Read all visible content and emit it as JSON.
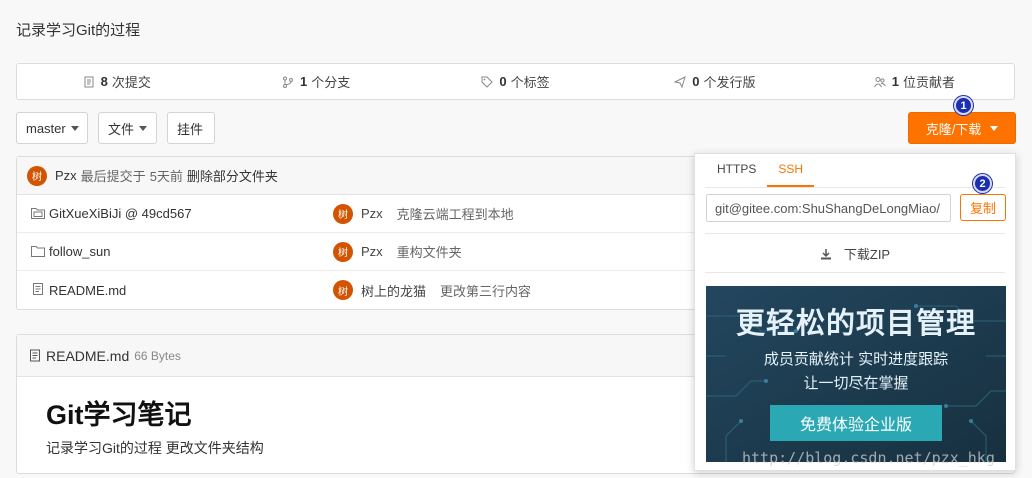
{
  "repo": {
    "description": "记录学习Git的过程"
  },
  "stats": [
    {
      "icon": "commit-icon",
      "count": "8",
      "label": "次提交"
    },
    {
      "icon": "branch-icon",
      "count": "1",
      "label": "个分支"
    },
    {
      "icon": "tag-icon",
      "count": "0",
      "label": "个标签"
    },
    {
      "icon": "release-icon",
      "count": "0",
      "label": "个发行版"
    },
    {
      "icon": "contributors-icon",
      "count": "1",
      "label": "位贡献者"
    }
  ],
  "toolbar": {
    "branch": "master",
    "file": "文件",
    "plugin": "挂件",
    "clone": "克隆/下载"
  },
  "markers": {
    "one": "1",
    "two": "2"
  },
  "latest_commit": {
    "avatar_char": "树",
    "author": "Pzx",
    "prefix": "最后提交于",
    "time": "5天前",
    "message": "删除部分文件夹"
  },
  "files": [
    {
      "icon": "submodule-folder-icon",
      "name": "GitXueXiBiJi @ 49cd567",
      "avatar_char": "树",
      "author": "Pzx",
      "message": "克隆云端工程到本地"
    },
    {
      "icon": "folder-icon",
      "name": "follow_sun",
      "avatar_char": "树",
      "author": "Pzx",
      "message": "重构文件夹"
    },
    {
      "icon": "file-icon",
      "name": "README.md",
      "avatar_char": "树",
      "author": "树上的龙猫",
      "message": "更改第三行内容"
    }
  ],
  "readme": {
    "filename": "README.md",
    "size": "66 Bytes",
    "title": "Git学习笔记",
    "text": "记录学习Git的过程 更改文件夹结构"
  },
  "clone_panel": {
    "tabs": [
      "HTTPS",
      "SSH"
    ],
    "active_tab": "SSH",
    "url": "git@gitee.com:ShuShangDeLongMiao/",
    "copy_label": "复制",
    "download_zip": "下载ZIP"
  },
  "promo": {
    "title": "更轻松的项目管理",
    "line1": "成员贡献统计   实时进度跟踪",
    "line2": "让一切尽在掌握",
    "button": "免费体验企业版"
  },
  "watermark": "http://blog.csdn.net/pzx_hkg",
  "colors": {
    "accent": "#fe7300",
    "promo_bg": "#1d3c53",
    "promo_button": "#2aa9b5",
    "avatar": "#d35400"
  }
}
